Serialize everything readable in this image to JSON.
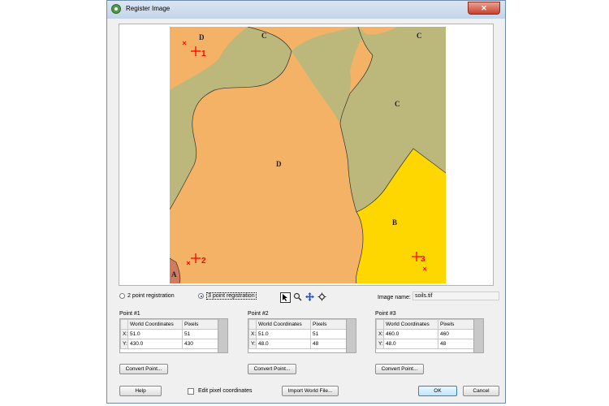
{
  "window": {
    "title": "Register Image",
    "close_symbol": "✕"
  },
  "map": {
    "zone_labels": {
      "d_top": "D",
      "c_left": "C",
      "c_right": "C",
      "c_mid": "C",
      "d_center": "D",
      "b": "B",
      "a": "A"
    },
    "markers": [
      {
        "label": "1"
      },
      {
        "label": "2"
      },
      {
        "label": "3"
      }
    ],
    "colors": {
      "d": "#f4b266",
      "c": "#bcb77a",
      "b": "#ffd700",
      "a": "#d27a5c",
      "marker": "#ff0000"
    }
  },
  "registration": {
    "two_point_label": "2 point registration",
    "three_point_label": "3 point registration",
    "selected": "3 point registration"
  },
  "tools": [
    "pointer-icon",
    "zoom-icon",
    "pan-icon",
    "recenter-icon"
  ],
  "image_name": {
    "label": "Image name:",
    "value": "soils.tif"
  },
  "points": [
    {
      "title": "Point #1",
      "col_world": "World Coordinates",
      "col_pixels": "Pixels",
      "x_label": "X:",
      "y_label": "Y:",
      "x_world": "51.0",
      "x_pixels": "51",
      "y_world": "430.0",
      "y_pixels": "430",
      "convert_label": "Convert Point..."
    },
    {
      "title": "Point #2",
      "col_world": "World Coordinates",
      "col_pixels": "Pixels",
      "x_label": "X:",
      "y_label": "Y:",
      "x_world": "51.0",
      "x_pixels": "51",
      "y_world": "48.0",
      "y_pixels": "48",
      "convert_label": "Convert Point..."
    },
    {
      "title": "Point #3",
      "col_world": "World Coordinates",
      "col_pixels": "Pixels",
      "x_label": "X:",
      "y_label": "Y:",
      "x_world": "460.0",
      "x_pixels": "460",
      "y_world": "48.0",
      "y_pixels": "48",
      "convert_label": "Convert Point..."
    }
  ],
  "footer": {
    "help_label": "Help",
    "edit_pixel_label": "Edit pixel coordinates",
    "edit_pixel_checked": false,
    "import_label": "Import World File...",
    "ok_label": "OK",
    "cancel_label": "Cancel"
  }
}
